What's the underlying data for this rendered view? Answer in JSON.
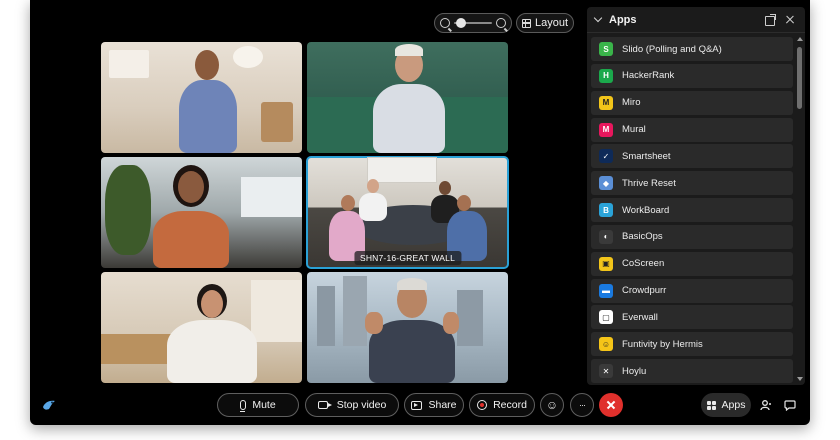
{
  "toolbar_top": {
    "layout_label": "Layout",
    "zoom_level": 0.18
  },
  "tiles": [
    {
      "id": "tile-1",
      "label": ""
    },
    {
      "id": "tile-2",
      "label": ""
    },
    {
      "id": "tile-3",
      "label": ""
    },
    {
      "id": "tile-4",
      "label": "SHN7-16-GREAT WALL"
    },
    {
      "id": "tile-5",
      "label": ""
    },
    {
      "id": "tile-6",
      "label": ""
    }
  ],
  "apps_panel": {
    "title": "Apps",
    "items": [
      {
        "label": "Slido (Polling and Q&A)",
        "icon": "slido-icon",
        "glyph": "S",
        "color": "#3ab44a"
      },
      {
        "label": "HackerRank",
        "icon": "hackerrank-icon",
        "glyph": "H",
        "color": "#1ba94c"
      },
      {
        "label": "Miro",
        "icon": "miro-icon",
        "glyph": "M",
        "color": "#f2c51a"
      },
      {
        "label": "Mural",
        "icon": "mural-icon",
        "glyph": "M",
        "color": "#e8175d"
      },
      {
        "label": "Smartsheet",
        "icon": "smartsheet-icon",
        "glyph": "✓",
        "color": "#0e2a58"
      },
      {
        "label": "Thrive Reset",
        "icon": "thrive-reset-icon",
        "glyph": "◆",
        "color": "#5b8fd6"
      },
      {
        "label": "WorkBoard",
        "icon": "workboard-icon",
        "glyph": "B",
        "color": "#2aa3d8"
      },
      {
        "label": "BasicOps",
        "icon": "basicops-icon",
        "glyph": "◐",
        "color": "#3a3a3a"
      },
      {
        "label": "CoScreen",
        "icon": "coscreen-icon",
        "glyph": "▣",
        "color": "#f2c51a"
      },
      {
        "label": "Crowdpurr",
        "icon": "crowdpurr-icon",
        "glyph": "▬",
        "color": "#1a7ae0"
      },
      {
        "label": "Everwall",
        "icon": "everwall-icon",
        "glyph": "▢",
        "color": "#ffffff"
      },
      {
        "label": "Funtivity by Hermis",
        "icon": "funtivity-icon",
        "glyph": "☺",
        "color": "#f5c518"
      },
      {
        "label": "Hoylu",
        "icon": "hoylu-icon",
        "glyph": "✕",
        "color": "#3a3a3a"
      }
    ]
  },
  "controls": {
    "mute": "Mute",
    "stop_video": "Stop video",
    "share": "Share",
    "record": "Record",
    "more": "···",
    "apps": "Apps"
  }
}
